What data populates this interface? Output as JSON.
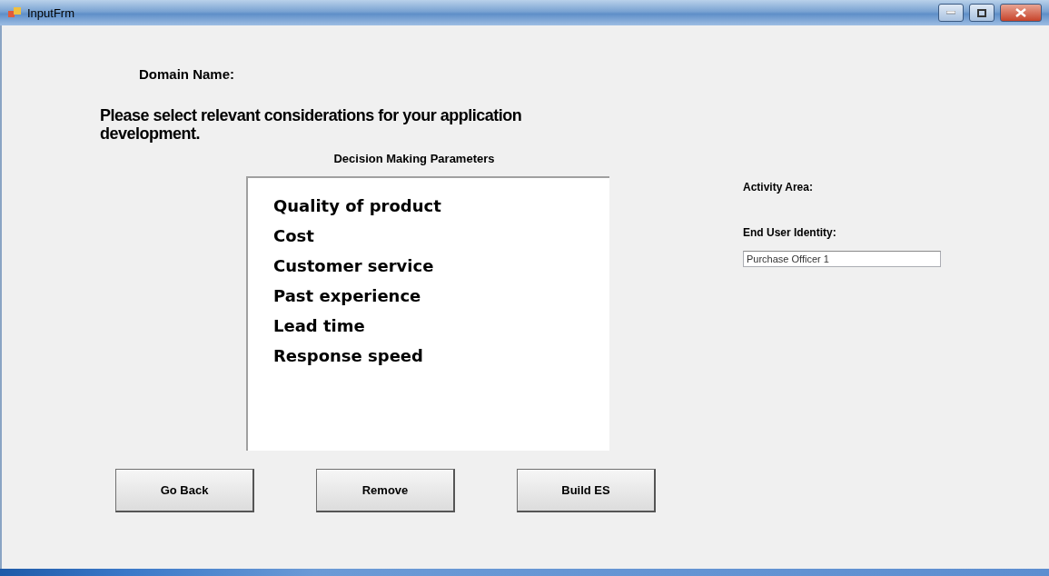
{
  "window": {
    "title": "InputFrm"
  },
  "domain_label": "Domain Name:",
  "instruction": "Please select relevant considerations for your application development.",
  "parameters": {
    "title": "Decision Making Parameters",
    "items": [
      {
        "label": "Quality of product"
      },
      {
        "label": "Cost"
      },
      {
        "label": "Customer service"
      },
      {
        "label": "Past experience"
      },
      {
        "label": "Lead time"
      },
      {
        "label": "Response speed"
      }
    ]
  },
  "activity_area_label": "Activity Area:",
  "end_user": {
    "label": "End User Identity:",
    "value": "Purchase Officer 1"
  },
  "buttons": [
    "Go Back",
    "Remove",
    "Build ES"
  ]
}
